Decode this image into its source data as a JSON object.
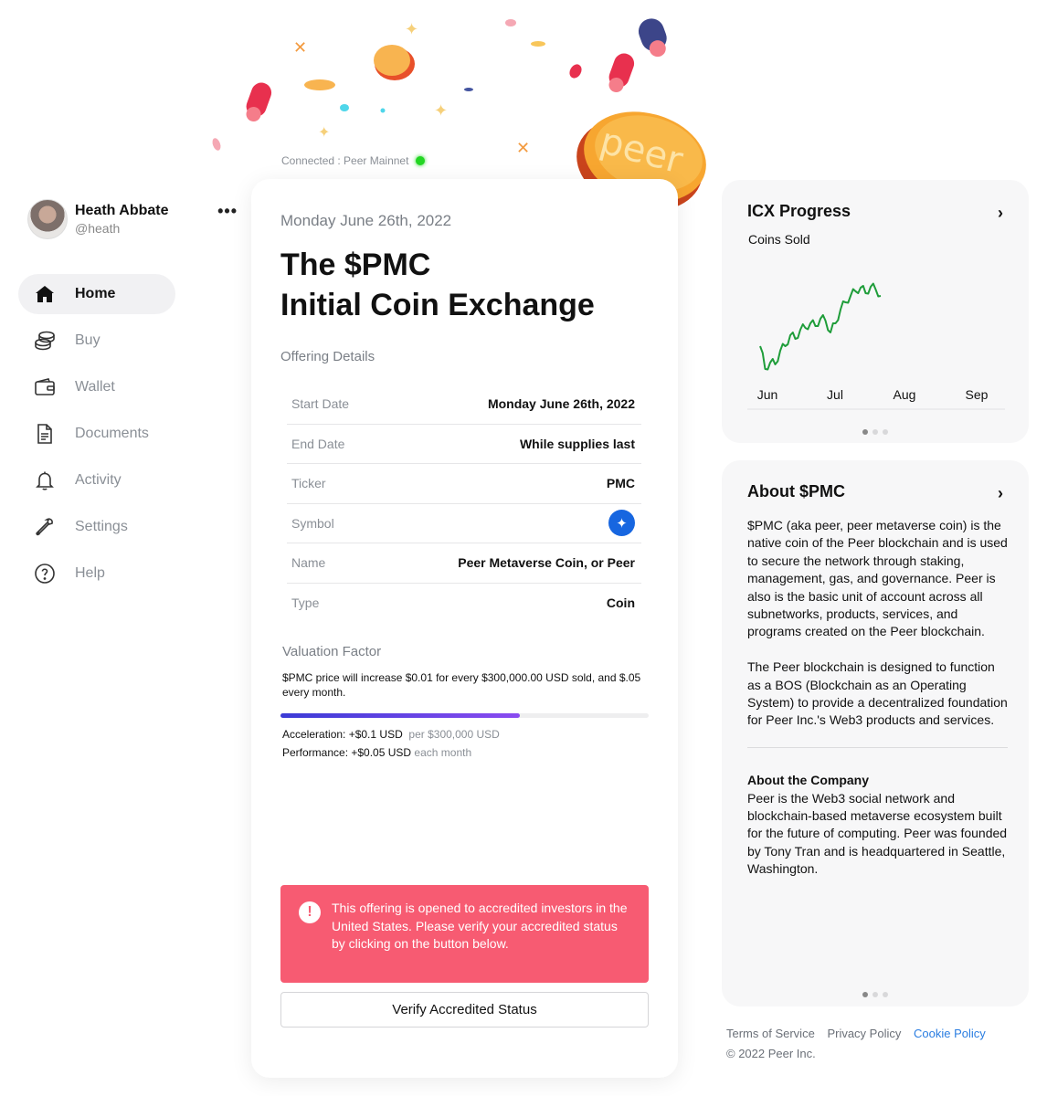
{
  "connection": {
    "text": "Connected : Peer Mainnet"
  },
  "user": {
    "name": "Heath Abbate",
    "handle": "@heath",
    "more_icon": "more-horizontal-icon"
  },
  "nav": [
    {
      "label": "Home",
      "icon": "home-icon",
      "active": true
    },
    {
      "label": "Buy",
      "icon": "coins-icon"
    },
    {
      "label": "Wallet",
      "icon": "wallet-icon"
    },
    {
      "label": "Documents",
      "icon": "document-icon"
    },
    {
      "label": "Activity",
      "icon": "bell-icon"
    },
    {
      "label": "Settings",
      "icon": "wrench-icon"
    },
    {
      "label": "Help",
      "icon": "help-circle-icon"
    }
  ],
  "offering": {
    "date": "Monday June 26th, 2022",
    "title_line1": "The $PMC",
    "title_line2": "Initial Coin Exchange",
    "details_label": "Offering Details",
    "details": [
      {
        "key": "Start Date",
        "value": "Monday June 26th, 2022"
      },
      {
        "key": "End Date",
        "value": "While supplies last"
      },
      {
        "key": "Ticker",
        "value": "PMC"
      },
      {
        "key": "Symbol",
        "value": "",
        "icon": "sparkle-icon"
      },
      {
        "key": "Name",
        "value": "Peer Metaverse Coin, or Peer"
      },
      {
        "key": "Type",
        "value": "Coin"
      }
    ],
    "valuation_label": "Valuation Factor",
    "valuation_text": "$PMC price will increase $0.01 for every $300,000.00 USD sold, and $.05 every month.",
    "progress_fraction": 0.65,
    "acceleration_label": "Acceleration: +$0.1 USD",
    "acceleration_sub": "per $300,000 USD",
    "performance_label": "Performance: +$0.05 USD",
    "performance_sub": "each month",
    "alert_text": "This offering is opened to accredited investors in the United States. Please verify your accredited status by clicking on the button below.",
    "verify_button": "Verify Accredited Status",
    "coin_label": "peer"
  },
  "progress_panel": {
    "title": "ICX Progress",
    "subtitle": "Coins Sold",
    "x_labels": [
      "Jun",
      "Jul",
      "Aug",
      "Sep"
    ]
  },
  "chart_data": {
    "type": "line",
    "title": "ICX Progress",
    "subtitle": "Coins Sold",
    "categories": [
      "Jun",
      "Jul",
      "Aug",
      "Sep"
    ],
    "series": [
      {
        "color": "#1f9d3a",
        "values": [
          0.3,
          0.05,
          0.12,
          0.1,
          0.25,
          0.3,
          0.42,
          0.38,
          0.48,
          0.5,
          0.55,
          0.52,
          0.6,
          0.58,
          0.45,
          0.55,
          0.7,
          0.78,
          0.85,
          0.9,
          0.94,
          0.88,
          0.95,
          0.92,
          0.85
        ]
      }
    ],
    "grid": false,
    "legend": "none"
  },
  "about_panel": {
    "title": "About $PMC",
    "p1": "$PMC (aka peer, peer metaverse coin) is the native coin of the Peer blockchain and is used to secure the network through staking, management, gas, and governance. Peer is also is the basic unit of account across all subnetworks, products, services, and programs created on the Peer blockchain.",
    "p2": "The Peer blockchain is designed to function as a BOS (Blockchain as an Operating System) to provide a decentralized foundation for Peer Inc.'s Web3 products and services.",
    "company_heading": "About the Company",
    "company_text": "Peer is the Web3 social network and blockchain-based metaverse ecosystem built for the future of computing. Peer was founded by Tony Tran and is headquartered in Seattle, Washington."
  },
  "footer": {
    "terms": "Terms of Service",
    "privacy": "Privacy Policy",
    "cookie": "Cookie Policy",
    "copyright": "© 2022 Peer Inc."
  },
  "colors": {
    "accent": "#2a7de1",
    "alert": "#f75b72",
    "chart_line": "#1f9d3a",
    "progress": "#5b3fe0"
  }
}
